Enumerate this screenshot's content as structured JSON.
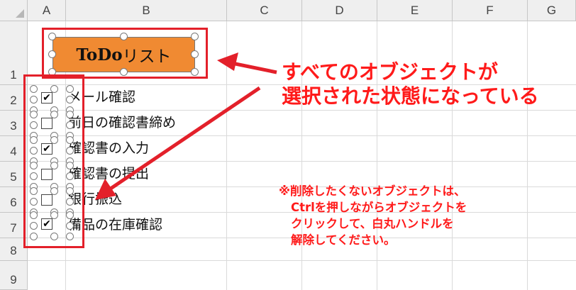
{
  "columns": [
    "A",
    "B",
    "C",
    "D",
    "E",
    "F",
    "G"
  ],
  "rows": [
    "1",
    "2",
    "3",
    "4",
    "5",
    "6",
    "7",
    "8",
    "9"
  ],
  "todo_title": {
    "bold_part": "ToDo",
    "rest": "リスト"
  },
  "tasks": [
    {
      "label": "メール確認",
      "checked": true
    },
    {
      "label": "前日の確認書締め",
      "checked": false
    },
    {
      "label": "確認書の入力",
      "checked": true
    },
    {
      "label": "確認書の提出",
      "checked": false
    },
    {
      "label": "銀行振込",
      "checked": false
    },
    {
      "label": "備品の在庫確認",
      "checked": true
    }
  ],
  "check_glyph": "✔",
  "annotation": {
    "line1": "すべてのオブジェクトが",
    "line2": "選択された状態になっている"
  },
  "note": {
    "line1": "※削除したくないオブジェクトは、",
    "line2": "Ctrlを押しながらオブジェクトを",
    "line3": "クリックして、白丸ハンドルを",
    "line4": "解除してください。"
  },
  "colors": {
    "accent_red": "#e3202a",
    "shape_orange": "#f08a32",
    "header_gray": "#efefef"
  }
}
